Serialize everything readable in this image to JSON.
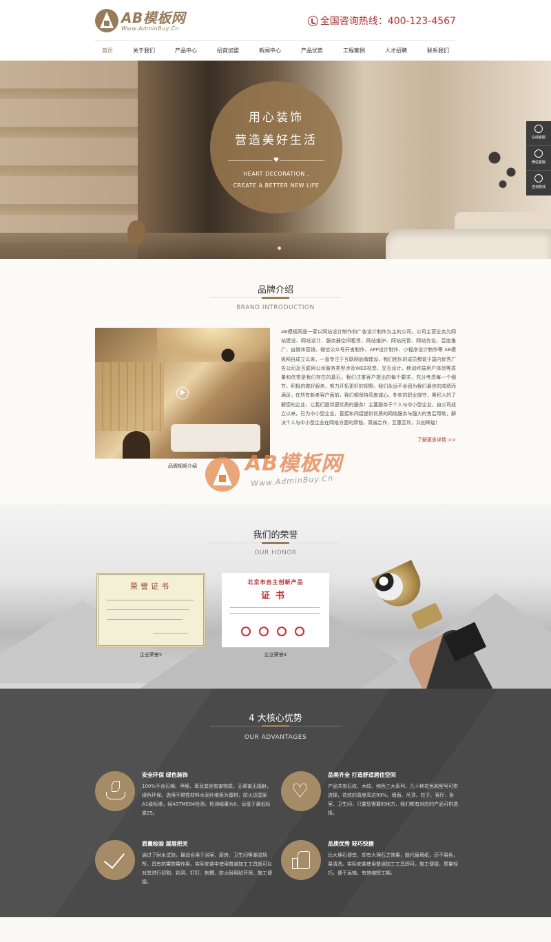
{
  "header": {
    "logo_title": "AB模板网",
    "logo_sub": "Www.AdminBuy.Cn",
    "hotline": "全国咨询热线：400-123-4567"
  },
  "nav": [
    "首页",
    "关于我们",
    "产品中心",
    "招商加盟",
    "新闻中心",
    "产品优势",
    "工程案例",
    "人才招聘",
    "联系我们"
  ],
  "hero": {
    "title1": "用心装饰",
    "title2": "营造美好生活",
    "en1": "HEART DECORATION ,",
    "en2": "CREATE A BETTER NEW LIFE"
  },
  "side_float": [
    "在线客服",
    "微信客服",
    "咨询热线"
  ],
  "brand": {
    "title": "品牌介绍",
    "subtitle": "BRAND INTRODUCTION",
    "caption": "品牌视频介绍",
    "text": "AB模板网是一家以网站设计制作和广告设计制作为主的公司。公司主营业务为网站建设、网站设计、服务器空间租赁、网站维护、网站托管、网站优化、百度推广、自媒体营销、微信公众号开发制作、APP设计制作、小程序设计制作等 AB模板网自成立以来，一直专注于互联网品牌建设，我们团队的成员都曾于国内优秀广告公司及互联网公司服务类型涉及WEB视觉、交互设计、移动终端用户体验等质量和信誉是我们存在的基石。我们注重客户提出的每个要求，充分考虑每一个细节，积极的做好服务，努力开拓更好的视野。我们永远不会因为我们最佳的成绩而满足，在所有新老客户面前，我们都保持高度诚心、朴实的职业操守，累积人的了解您的企业，让我们提供更优质的服务！主要服务于个人与中小型企业，自公司成立以来，已为中小型企业，直接和间接提供优质的网络服务与强大的售后帮助，解决个人与中小型企业在网络方面的烦恼，真诚合作，互惠互利，共创辉煌！",
    "more": "了解更多详情 >>"
  },
  "watermark": {
    "title": "AB模板网",
    "sub": "Www.AdminBuy.Cn"
  },
  "honor": {
    "title": "我们的荣誉",
    "subtitle": "OUR HONOR",
    "cert1_title": "荣誉证书",
    "cert2_title": "北京市自主创新产品",
    "cert2_sub": "证书",
    "items": [
      "企业荣誉5",
      "企业荣誉4"
    ]
  },
  "advantages": {
    "title": "4 大核心优势",
    "subtitle": "OUR ADVANTAGES",
    "items": [
      {
        "icon": "leaf-hand-icon",
        "title": "安全环保 绿色装饰",
        "desc": "100%不含石棉、甲醛、苯及其他有害物质，无毒害无辐射，绿色环保。选用不燃性材料水泥纤维板为基材，防火达国家A1级标准，经ASTME84检测，检测结果为0，远低于最低标准25。"
      },
      {
        "icon": "heart-icon",
        "title": "品类齐全 打造舒适居住空间",
        "desc": "产品共有石纹、木纹、纯色三大系列，几十种花色和型号可供选择，花纹的真度高达99%。墙面、吊顶、柱子、客厅、卧室、卫生间，只要您需要的地方，我们都有对应的产品可供选择。"
      },
      {
        "icon": "check-icon",
        "title": "质量检验 层层把关",
        "desc": "通过了耐水试验，最适合用于浴室、厨房、卫生间等潮湿场所，具有抗霉防霉作用，实际安装中使用普通加工工具就可以对其进行切割、钻洞、钉钉、刨槽，防火耐用贴环保，施工便捷。"
      },
      {
        "icon": "thumbs-up-icon",
        "title": "品质优秀 轻巧快捷",
        "desc": "比大理石便宜，却有大理石之效果，能代替墙纸，还不易色，易清洗。实际安装使用普通加工工具即可，施工便捷，质量轻巧，便于运输，有效缩短工期。"
      }
    ]
  }
}
